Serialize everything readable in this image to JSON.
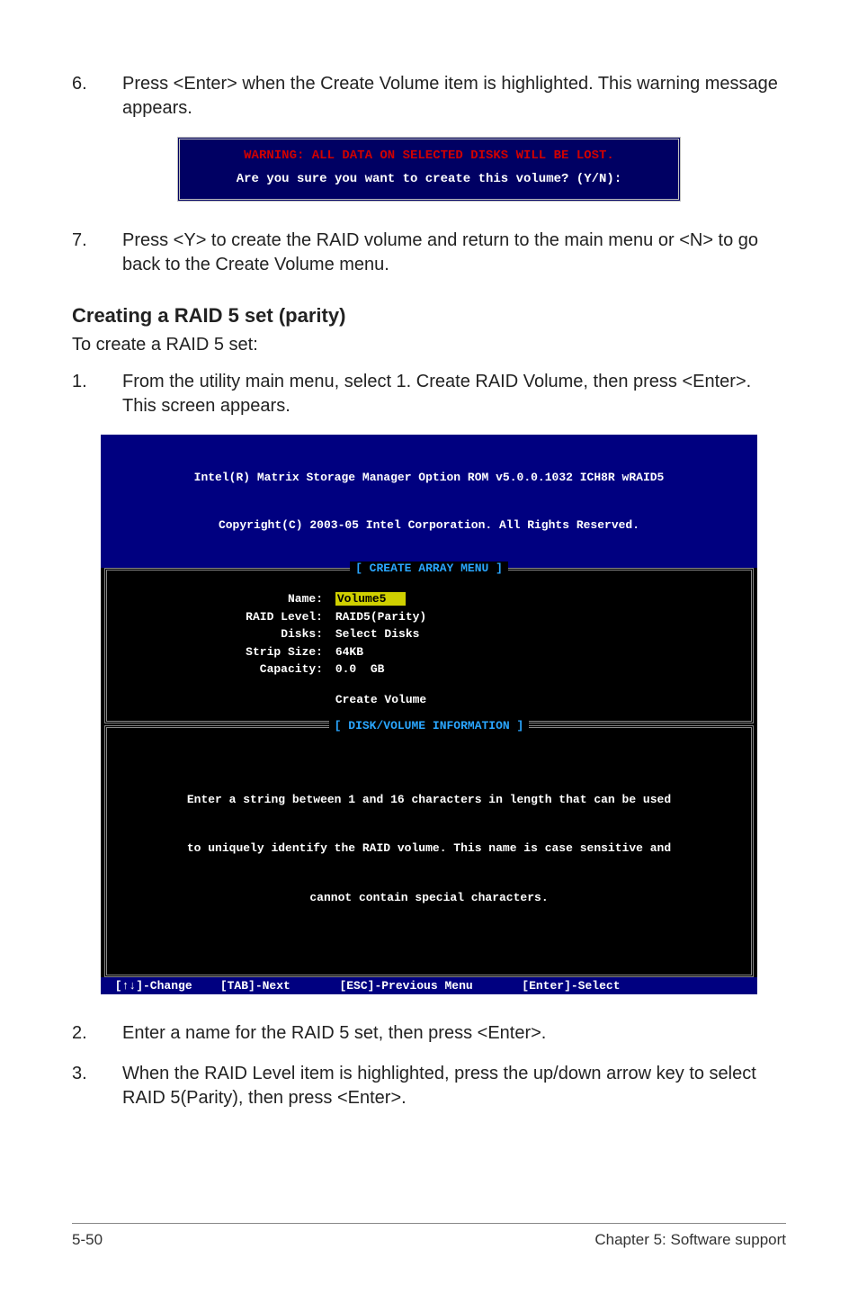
{
  "steps": {
    "s6_num": "6.",
    "s6_txt": "Press <Enter> when the Create Volume item is highlighted. This warning message appears.",
    "s7_num": "7.",
    "s7_txt": "Press <Y> to create the RAID volume and return to the main menu or <N> to go back to the Create Volume menu.",
    "s1_num": "1.",
    "s1_txt": "From the utility main menu, select 1. Create RAID Volume, then press <Enter>. This screen appears.",
    "s2_num": "2.",
    "s2_txt": "Enter a name for the RAID 5 set, then press <Enter>.",
    "s3_num": "3.",
    "s3_txt": "When the RAID Level item is highlighted, press the up/down arrow key to select RAID 5(Parity), then press <Enter>."
  },
  "warning": {
    "line1": "WARNING: ALL DATA ON SELECTED DISKS WILL BE LOST.",
    "line2": "Are you sure you want to create this volume? (Y/N):"
  },
  "section_title": "Creating a RAID 5 set (parity)",
  "section_sub": "To create a RAID 5 set:",
  "bios": {
    "header1": "Intel(R) Matrix Storage Manager Option ROM v5.0.0.1032 ICH8R wRAID5",
    "header2": "Copyright(C) 2003-05 Intel Corporation. All Rights Reserved.",
    "create_caption": "[ CREATE ARRAY MENU ]",
    "disk_caption": "[ DISK/VOLUME INFORMATION ]",
    "fields": {
      "name_label": "Name:",
      "name_value": "Volume5",
      "raid_label": "RAID Level:",
      "raid_value": "RAID5(Parity)",
      "disks_label": "Disks:",
      "disks_value": "Select Disks",
      "strip_label": "Strip Size:",
      "strip_value": "64KB",
      "cap_label": "Capacity:",
      "cap_value": "0.0  GB",
      "create_vol": "Create Volume"
    },
    "help1": "Enter a string between 1 and 16 characters in length that can be used",
    "help2": "to uniquely identify the RAID volume. This name is case sensitive and",
    "help3": "cannot contain special characters.",
    "footer": " [↑↓]-Change    [TAB]-Next       [ESC]-Previous Menu       [Enter]-Select"
  },
  "footer": {
    "left": "5-50",
    "right": "Chapter 5: Software support"
  }
}
